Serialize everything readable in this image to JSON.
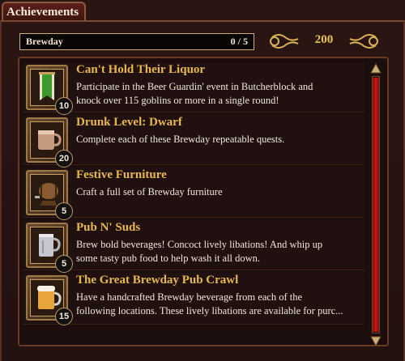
{
  "window": {
    "tab_title": "Achievements"
  },
  "header": {
    "category": "Brewday",
    "progress": "0 / 5"
  },
  "points": {
    "total": "200"
  },
  "achievements": [
    {
      "title": "Can't Hold Their Liquor",
      "description": "Participate in the Beer Guardin' event in Butcherblock and\nknock over 115 goblins or more in a single round!",
      "points": "10",
      "icon": "green-banner-icon"
    },
    {
      "title": "Drunk Level: Dwarf",
      "description": "Complete each of these Brewday repeatable quests.",
      "points": "20",
      "icon": "mug-icon"
    },
    {
      "title": "Festive Furniture",
      "description": "Craft a full set of Brewday furniture",
      "points": "5",
      "icon": "keg-icon"
    },
    {
      "title": "Pub N' Suds",
      "description": "Brew bold beverages! Concoct lively libations! And whip up\nsome tasty pub food to help wash it all down.",
      "points": "5",
      "icon": "tankard-icon"
    },
    {
      "title": "The Great Brewday Pub Crawl",
      "description": "Have a handcrafted Brewday beverage from each of the\nfollowing locations. These lively libations are available for purc...",
      "points": "15",
      "icon": "beer-stein-icon"
    }
  ]
}
